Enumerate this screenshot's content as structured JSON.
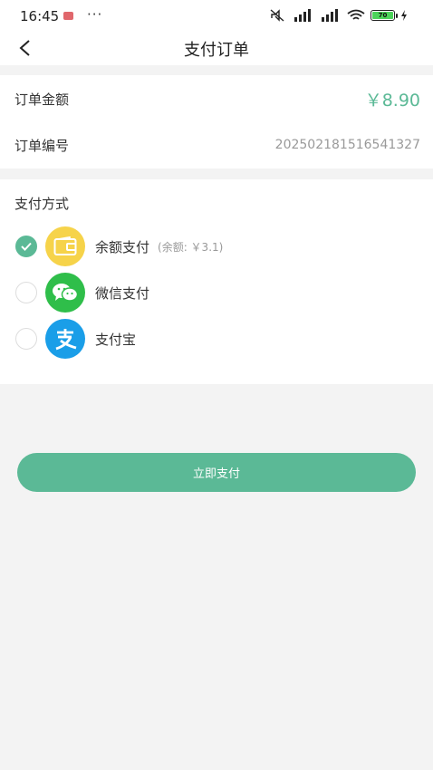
{
  "status_bar": {
    "time": "16:45",
    "dots": "···",
    "battery": "70"
  },
  "nav": {
    "title": "支付订单"
  },
  "order": {
    "amount_label": "订单金额",
    "amount_value": "￥8.90",
    "number_label": "订单编号",
    "number_value": "202502181516541327"
  },
  "payment": {
    "section_title": "支付方式",
    "methods": [
      {
        "name": "余额支付",
        "extra": "(余额: ￥3.1)",
        "selected": true,
        "icon": "wallet-icon",
        "icon_color": "#f6d34a"
      },
      {
        "name": "微信支付",
        "extra": "",
        "selected": false,
        "icon": "wechat-icon",
        "icon_color": "#2fbe4a"
      },
      {
        "name": "支付宝",
        "extra": "",
        "selected": false,
        "icon": "alipay-icon",
        "icon_color": "#1a9ee8"
      }
    ]
  },
  "action": {
    "pay_now": "立即支付"
  },
  "colors": {
    "accent": "#5bb996",
    "background": "#f3f3f3"
  }
}
